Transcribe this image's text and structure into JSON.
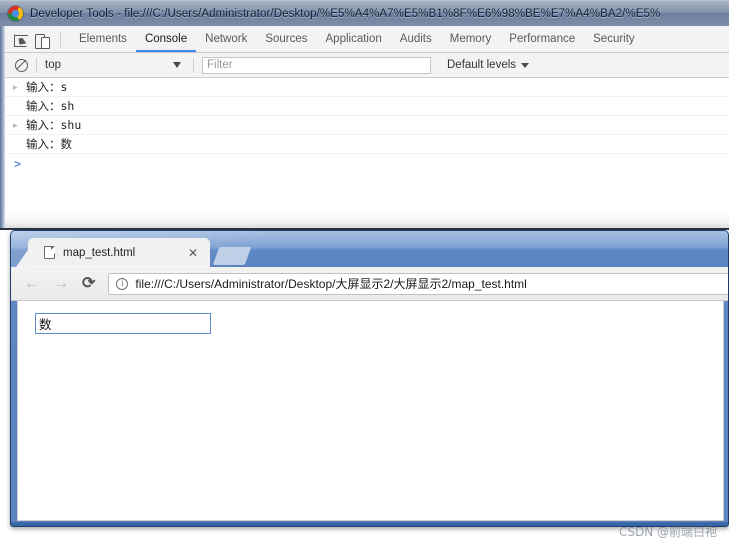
{
  "devtools": {
    "title": "Developer Tools - file:///C:/Users/Administrator/Desktop/%E5%A4%A7%E5%B1%8F%E6%98%BE%E7%A4%BA2/%E5%",
    "logo_icon": "chrome-logo-icon",
    "toolbar_icons": {
      "inspect": "inspect-element-icon",
      "device": "device-toolbar-icon"
    },
    "tabs": [
      {
        "label": "Elements",
        "selected": false
      },
      {
        "label": "Console",
        "selected": true
      },
      {
        "label": "Network",
        "selected": false
      },
      {
        "label": "Sources",
        "selected": false
      },
      {
        "label": "Application",
        "selected": false
      },
      {
        "label": "Audits",
        "selected": false
      },
      {
        "label": "Memory",
        "selected": false
      },
      {
        "label": "Performance",
        "selected": false
      },
      {
        "label": "Security",
        "selected": false
      }
    ],
    "console_filterbar": {
      "clear_icon": "clear-console-icon",
      "context": "top",
      "context_caret_icon": "chevron-down-icon",
      "filter_placeholder": "Filter",
      "filter_value": "",
      "levels_label": "Default levels",
      "levels_caret_icon": "chevron-down-icon"
    },
    "console_messages": [
      {
        "text": "输入：s",
        "expandable": true
      },
      {
        "text": "输入：sh",
        "expandable": false
      },
      {
        "text": "输入：shu",
        "expandable": true
      },
      {
        "text": "输入：数",
        "expandable": false
      }
    ],
    "console_prompt": ">"
  },
  "browser": {
    "tab": {
      "favicon": "page-document-icon",
      "title": "map_test.html",
      "close_label": "✕"
    },
    "toolbar": {
      "back_label": "←",
      "forward_label": "→",
      "reload_label": "⟳",
      "site_info_icon": "info-circle-icon",
      "url": "file:///C:/Users/Administrator/Desktop/大屏显示2/大屏显示2/map_test.html"
    },
    "page": {
      "text_input_value": "数",
      "text_input_placeholder": ""
    }
  },
  "watermark": "CSDN @前端白袍",
  "colors": {
    "devtools_selected_tab_underline": "#4285f4",
    "browser_frame": "#5c83c0",
    "page_input_border": "#5b8fd0"
  }
}
